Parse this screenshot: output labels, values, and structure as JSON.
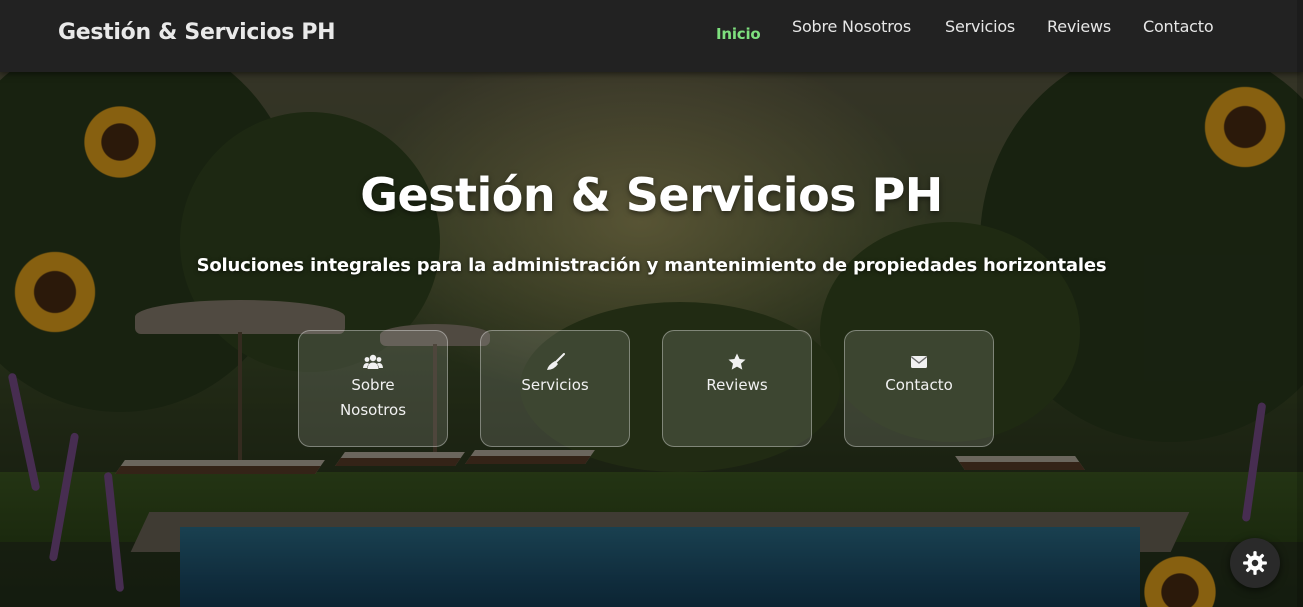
{
  "navbar": {
    "brand": "Gestión & Servicios PH",
    "links": [
      {
        "label": "Inicio",
        "active": true
      },
      {
        "label": "Sobre Nosotros",
        "active": false
      },
      {
        "label": "Servicios",
        "active": false
      },
      {
        "label": "Reviews",
        "active": false
      },
      {
        "label": "Contacto",
        "active": false
      }
    ]
  },
  "hero": {
    "title": "Gestión & Servicios PH",
    "subtitle": "Soluciones integrales para la administración y mantenimiento de propiedades horizontales",
    "cards": [
      {
        "label": "Sobre Nosotros",
        "icon": "users-icon"
      },
      {
        "label": "Servicios",
        "icon": "broom-icon"
      },
      {
        "label": "Reviews",
        "icon": "star-icon"
      },
      {
        "label": "Contacto",
        "icon": "envelope-icon"
      }
    ]
  },
  "settings": {
    "icon": "gear-icon"
  },
  "colors": {
    "navbar_bg": "#222222",
    "active_link": "#7ee07e",
    "text": "#ffffff"
  }
}
